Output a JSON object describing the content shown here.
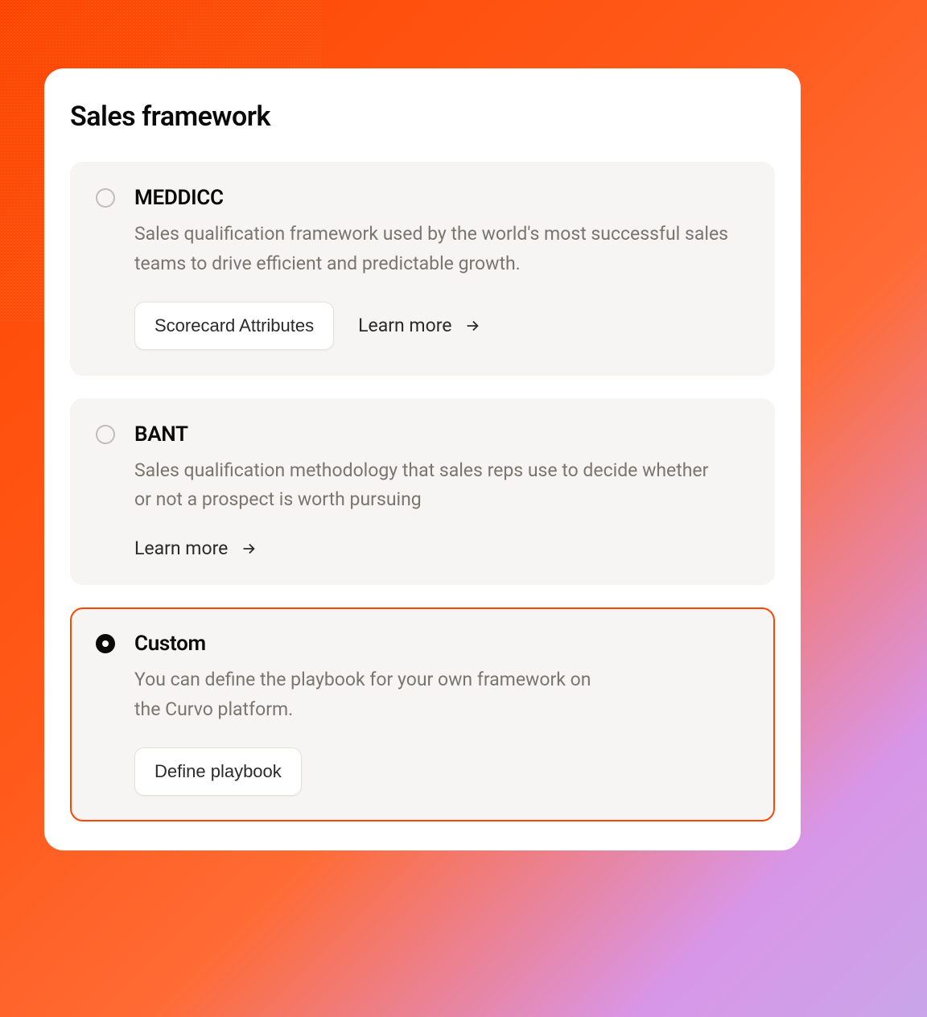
{
  "card": {
    "title": "Sales framework"
  },
  "options": [
    {
      "title": "MEDDICC",
      "description": "Sales qualification framework used by the world's most successful sales teams to drive efficient and predictable growth.",
      "primary_button": "Scorecard Attributes",
      "learn_more": "Learn more",
      "selected": false
    },
    {
      "title": "BANT",
      "description": "Sales qualification methodology that sales reps use to decide whether or not a prospect is worth pursuing",
      "learn_more": "Learn more",
      "selected": false
    },
    {
      "title": "Custom",
      "description": "You can define the playbook for your own framework on the Curvo platform.",
      "primary_button": "Define playbook",
      "selected": true
    }
  ]
}
